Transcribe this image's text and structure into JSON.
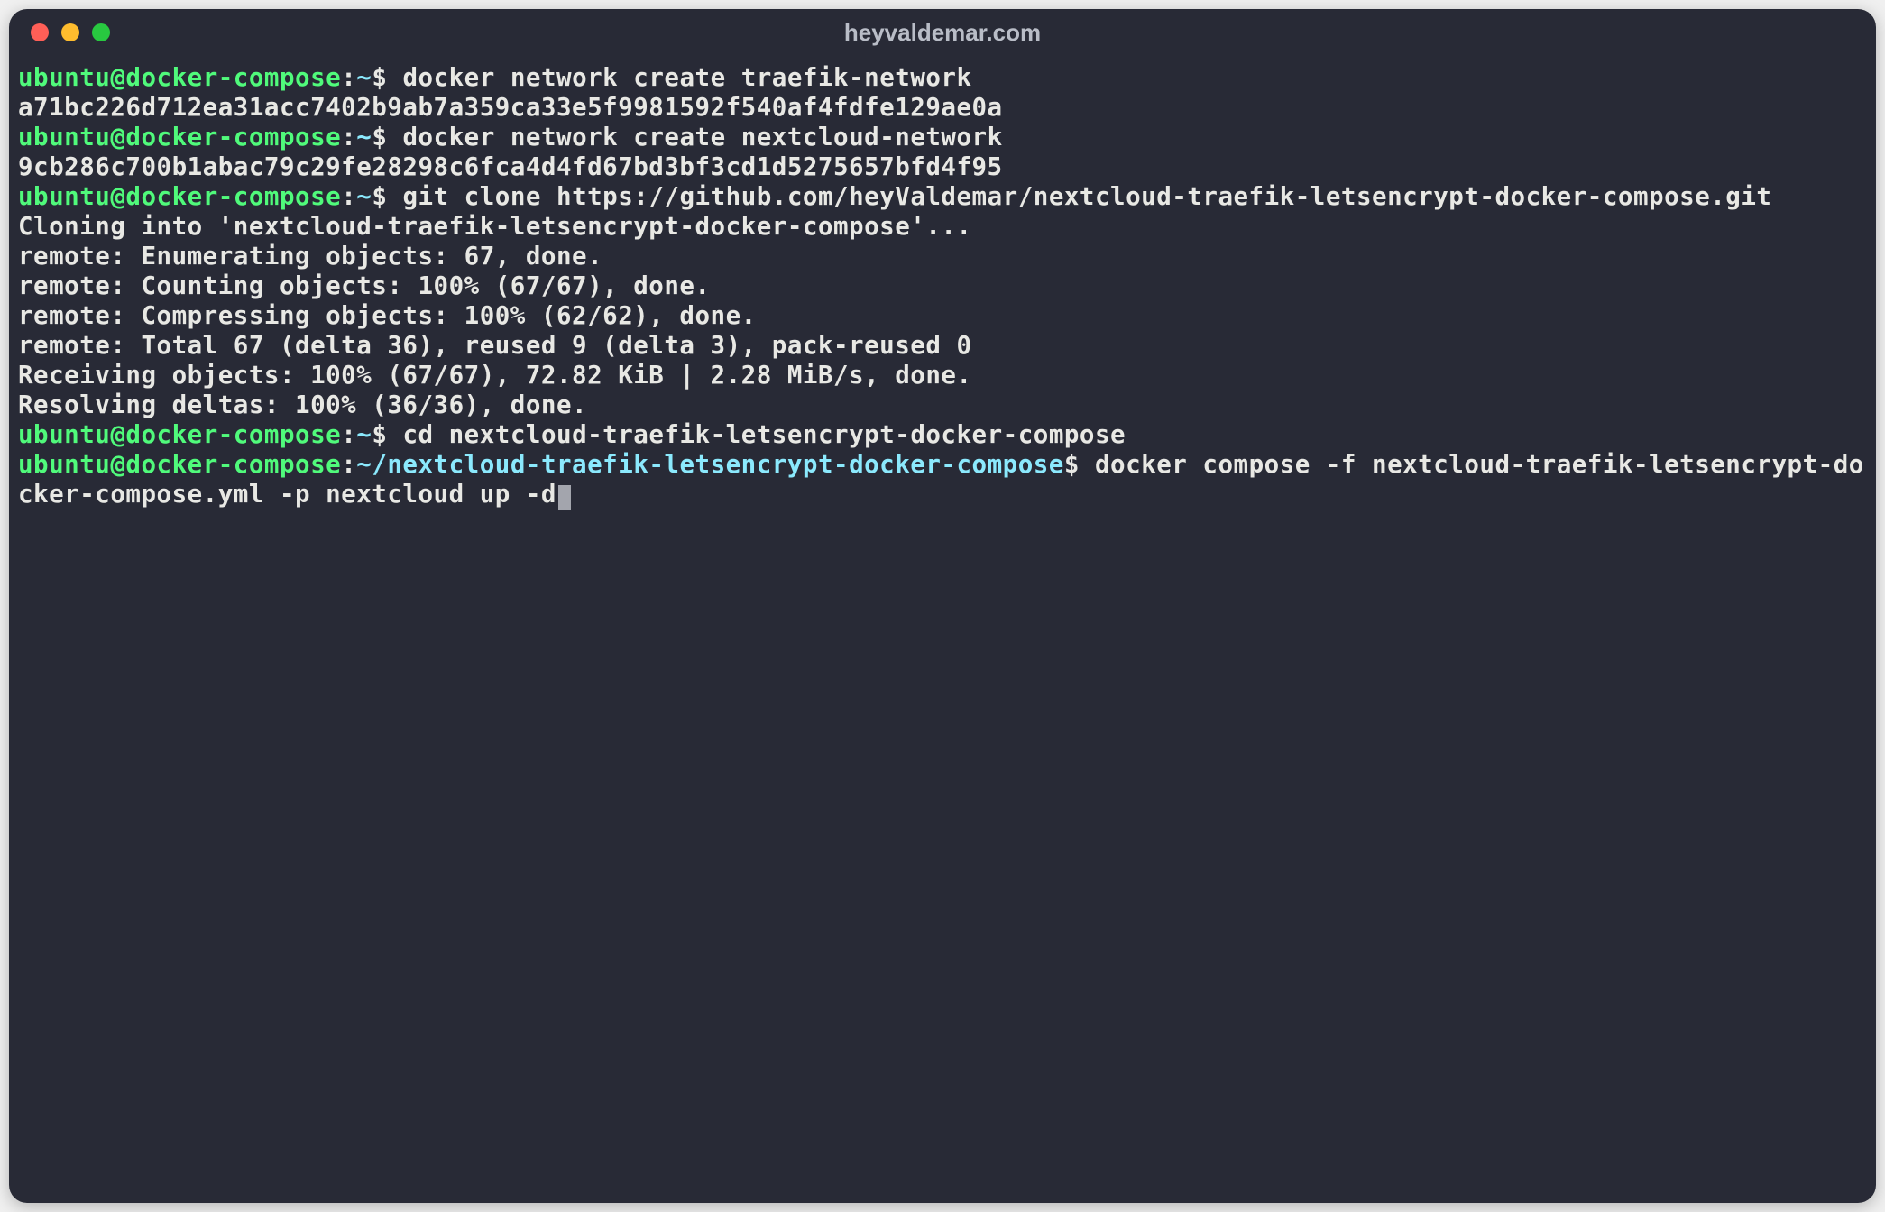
{
  "window": {
    "title": "heyvaldemar.com"
  },
  "colors": {
    "bg": "#282a36",
    "text": "#e8e8e4",
    "user": "#50fa7b",
    "path": "#8be9fd",
    "close": "#ff5f57",
    "minimize": "#febc2e",
    "maximize": "#28c840"
  },
  "prompts": [
    {
      "user": "ubuntu",
      "host": "docker-compose",
      "path": "~",
      "command": "docker network create traefik-network",
      "output": [
        "a71bc226d712ea31acc7402b9ab7a359ca33e5f9981592f540af4fdfe129ae0a"
      ]
    },
    {
      "user": "ubuntu",
      "host": "docker-compose",
      "path": "~",
      "command": "docker network create nextcloud-network",
      "output": [
        "9cb286c700b1abac79c29fe28298c6fca4d4fd67bd3bf3cd1d5275657bfd4f95"
      ]
    },
    {
      "user": "ubuntu",
      "host": "docker-compose",
      "path": "~",
      "command": "git clone https://github.com/heyValdemar/nextcloud-traefik-letsencrypt-docker-compose.git",
      "output": [
        "Cloning into 'nextcloud-traefik-letsencrypt-docker-compose'...",
        "remote: Enumerating objects: 67, done.",
        "remote: Counting objects: 100% (67/67), done.",
        "remote: Compressing objects: 100% (62/62), done.",
        "remote: Total 67 (delta 36), reused 9 (delta 3), pack-reused 0",
        "Receiving objects: 100% (67/67), 72.82 KiB | 2.28 MiB/s, done.",
        "Resolving deltas: 100% (36/36), done."
      ]
    },
    {
      "user": "ubuntu",
      "host": "docker-compose",
      "path": "~",
      "command": "cd nextcloud-traefik-letsencrypt-docker-compose",
      "output": []
    },
    {
      "user": "ubuntu",
      "host": "docker-compose",
      "path": "~/nextcloud-traefik-letsencrypt-docker-compose",
      "command": "docker compose -f nextcloud-traefik-letsencrypt-docker-compose.yml -p nextcloud up -d",
      "output": [],
      "cursor": true
    }
  ]
}
